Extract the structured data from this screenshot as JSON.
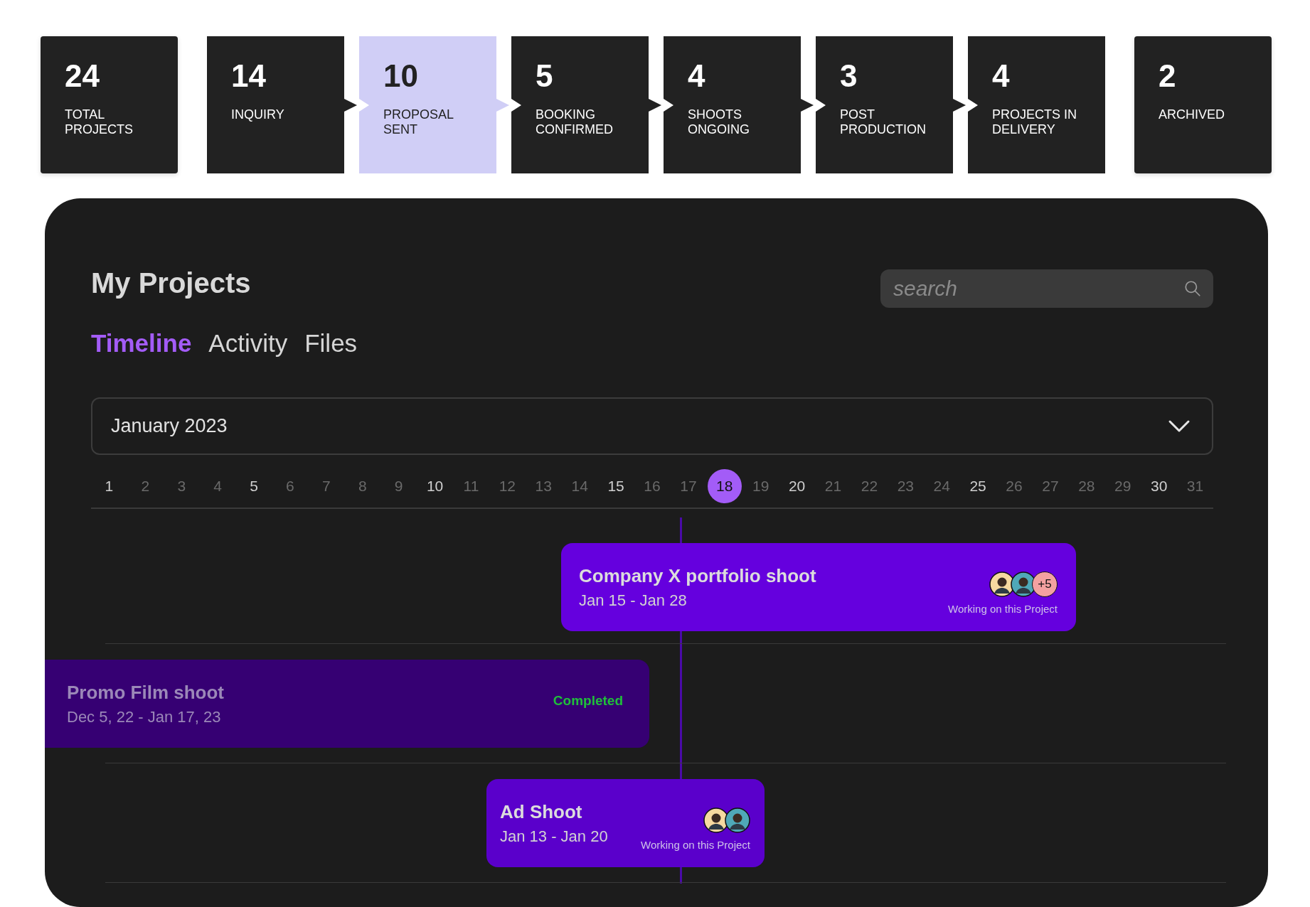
{
  "stages": [
    {
      "count": "24",
      "label": "TOTAL PROJECTS",
      "selected": false
    },
    {
      "count": "14",
      "label": "INQUIRY",
      "selected": false
    },
    {
      "count": "10",
      "label": "PROPOSAL SENT",
      "selected": true
    },
    {
      "count": "5",
      "label": "BOOKING CONFIRMED",
      "selected": false
    },
    {
      "count": "4",
      "label": "SHOOTS ONGOING",
      "selected": false
    },
    {
      "count": "3",
      "label": "POST PRODUCTION",
      "selected": false
    },
    {
      "count": "4",
      "label": "PROJECTS IN DELIVERY",
      "selected": false
    },
    {
      "count": "2",
      "label": "ARCHIVED",
      "selected": false
    }
  ],
  "panel": {
    "title": "My Projects",
    "search": {
      "placeholder": "search"
    },
    "tabs": [
      {
        "label": "Timeline",
        "selected": true
      },
      {
        "label": "Activity",
        "selected": false
      },
      {
        "label": "Files",
        "selected": false
      }
    ],
    "month": "January 2023",
    "days": [
      {
        "label": "1",
        "major": true,
        "selected": false
      },
      {
        "label": "2",
        "major": false,
        "selected": false
      },
      {
        "label": "3",
        "major": false,
        "selected": false
      },
      {
        "label": "4",
        "major": false,
        "selected": false
      },
      {
        "label": "5",
        "major": true,
        "selected": false
      },
      {
        "label": "6",
        "major": false,
        "selected": false
      },
      {
        "label": "7",
        "major": false,
        "selected": false
      },
      {
        "label": "8",
        "major": false,
        "selected": false
      },
      {
        "label": "9",
        "major": false,
        "selected": false
      },
      {
        "label": "10",
        "major": true,
        "selected": false
      },
      {
        "label": "11",
        "major": false,
        "selected": false
      },
      {
        "label": "12",
        "major": false,
        "selected": false
      },
      {
        "label": "13",
        "major": false,
        "selected": false
      },
      {
        "label": "14",
        "major": false,
        "selected": false
      },
      {
        "label": "15",
        "major": true,
        "selected": false
      },
      {
        "label": "16",
        "major": false,
        "selected": false
      },
      {
        "label": "17",
        "major": false,
        "selected": false
      },
      {
        "label": "18",
        "major": false,
        "selected": true
      },
      {
        "label": "19",
        "major": false,
        "selected": false
      },
      {
        "label": "20",
        "major": true,
        "selected": false
      },
      {
        "label": "21",
        "major": false,
        "selected": false
      },
      {
        "label": "22",
        "major": false,
        "selected": false
      },
      {
        "label": "23",
        "major": false,
        "selected": false
      },
      {
        "label": "24",
        "major": false,
        "selected": false
      },
      {
        "label": "25",
        "major": true,
        "selected": false
      },
      {
        "label": "26",
        "major": false,
        "selected": false
      },
      {
        "label": "27",
        "major": false,
        "selected": false
      },
      {
        "label": "28",
        "major": false,
        "selected": false
      },
      {
        "label": "29",
        "major": false,
        "selected": false
      },
      {
        "label": "30",
        "major": true,
        "selected": false
      },
      {
        "label": "31",
        "major": false,
        "selected": false
      }
    ],
    "projects": [
      {
        "kind": "active",
        "title": "Company X portfolio shoot",
        "dates": "Jan 15 - Jan 28",
        "avatars": [
          {
            "color": "#f6d9a0"
          },
          {
            "color": "#4fa8b8"
          }
        ],
        "more": "+5",
        "note": "Working on this Project"
      },
      {
        "kind": "completed",
        "title": "Promo Film shoot",
        "dates": "Dec 5, 22 - Jan 17, 23",
        "status": "Completed"
      },
      {
        "kind": "active",
        "title": "Ad Shoot",
        "dates": "Jan 13 - Jan 20",
        "avatars": [
          {
            "color": "#f6d9a0"
          },
          {
            "color": "#4fa8b8"
          }
        ],
        "note": "Working on this Project"
      }
    ]
  }
}
